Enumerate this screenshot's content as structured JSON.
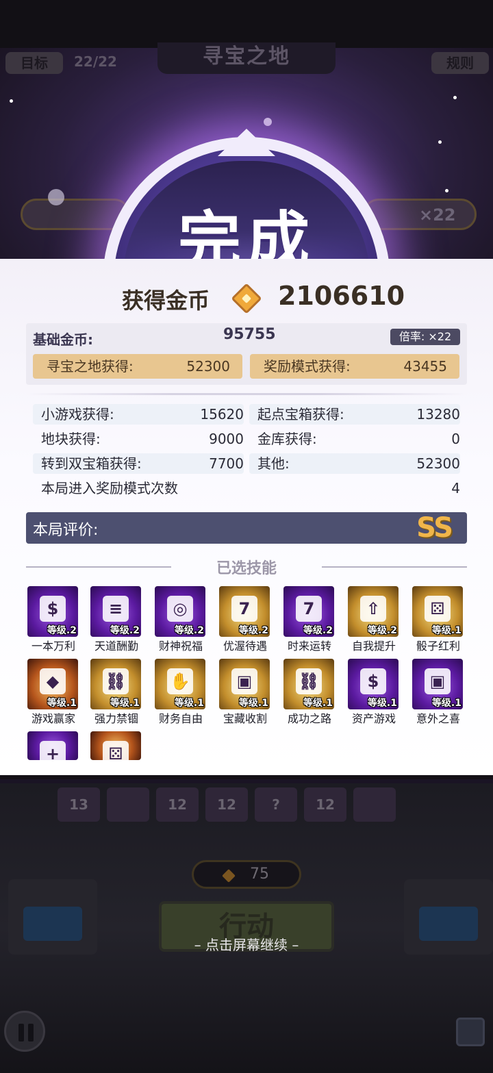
{
  "header": {
    "goal_button": "目标",
    "progress": "22/22",
    "title": "寻宝之地",
    "rules_button": "规则",
    "bg_multiplier": "×22"
  },
  "badge": {
    "text": "完成"
  },
  "results": {
    "total_label": "获得金币",
    "total_value": "2106610",
    "base_label": "基础金币:",
    "base_value": "95755",
    "rate_label": "倍率: ×22",
    "treasure_label": "寻宝之地获得:",
    "treasure_value": "52300",
    "reward_mode_label": "奖励模式获得:",
    "reward_mode_value": "43455",
    "stats": [
      {
        "label": "小游戏获得:",
        "value": "15620"
      },
      {
        "label": "起点宝箱获得:",
        "value": "13280"
      },
      {
        "label": "地块获得:",
        "value": "9000"
      },
      {
        "label": "金库获得:",
        "value": "0"
      },
      {
        "label": "转到双宝箱获得:",
        "value": "7700"
      },
      {
        "label": "其他:",
        "value": "52300"
      },
      {
        "label": "本局进入奖励模式次数",
        "value": "4"
      }
    ],
    "rating_label": "本局评价:",
    "rating_grade": "SS",
    "skills_title": "已选技能"
  },
  "skills": [
    {
      "name": "一本万利",
      "level": "等级.2",
      "tier": "purple",
      "icon": "money-bag-icon"
    },
    {
      "name": "天道酬勤",
      "level": "等级.2",
      "tier": "purple",
      "icon": "coin-stack-icon"
    },
    {
      "name": "财神祝福",
      "level": "等级.2",
      "tier": "purple",
      "icon": "coins-icon"
    },
    {
      "name": "优渥待遇",
      "level": "等级.2",
      "tier": "gold",
      "icon": "slot-seven-icon"
    },
    {
      "name": "时来运转",
      "level": "等级.2",
      "tier": "purple",
      "icon": "slot-seven-icon"
    },
    {
      "name": "自我提升",
      "level": "等级.2",
      "tier": "gold",
      "icon": "arrow-up-icon"
    },
    {
      "name": "骰子红利",
      "level": "等级.1",
      "tier": "gold",
      "icon": "dice-icon"
    },
    {
      "name": "游戏赢家",
      "level": "等级.1",
      "tier": "orange",
      "icon": "diamond-icon"
    },
    {
      "name": "强力禁锢",
      "level": "等级.1",
      "tier": "gold",
      "icon": "chains-icon"
    },
    {
      "name": "财务自由",
      "level": "等级.1",
      "tier": "gold",
      "icon": "hands-icon"
    },
    {
      "name": "宝藏收割",
      "level": "等级.1",
      "tier": "gold",
      "icon": "chest-icon"
    },
    {
      "name": "成功之路",
      "level": "等级.1",
      "tier": "gold",
      "icon": "chains-icon"
    },
    {
      "name": "资产游戏",
      "level": "等级.1",
      "tier": "purple",
      "icon": "money-bag-icon"
    },
    {
      "name": "意外之喜",
      "level": "等级.1",
      "tier": "purple",
      "icon": "chest-icon"
    },
    {
      "name": "",
      "level": "",
      "tier": "purple",
      "icon": "coins-plus-icon"
    },
    {
      "name": "",
      "level": "",
      "tier": "orange",
      "icon": "dice-icon"
    }
  ],
  "board": {
    "tile_values": [
      "13",
      "",
      "12",
      "12",
      "?",
      "12",
      ""
    ],
    "coin_count": "75",
    "action_button": "行动",
    "continue_hint": "– 点击屏幕继续 –"
  }
}
